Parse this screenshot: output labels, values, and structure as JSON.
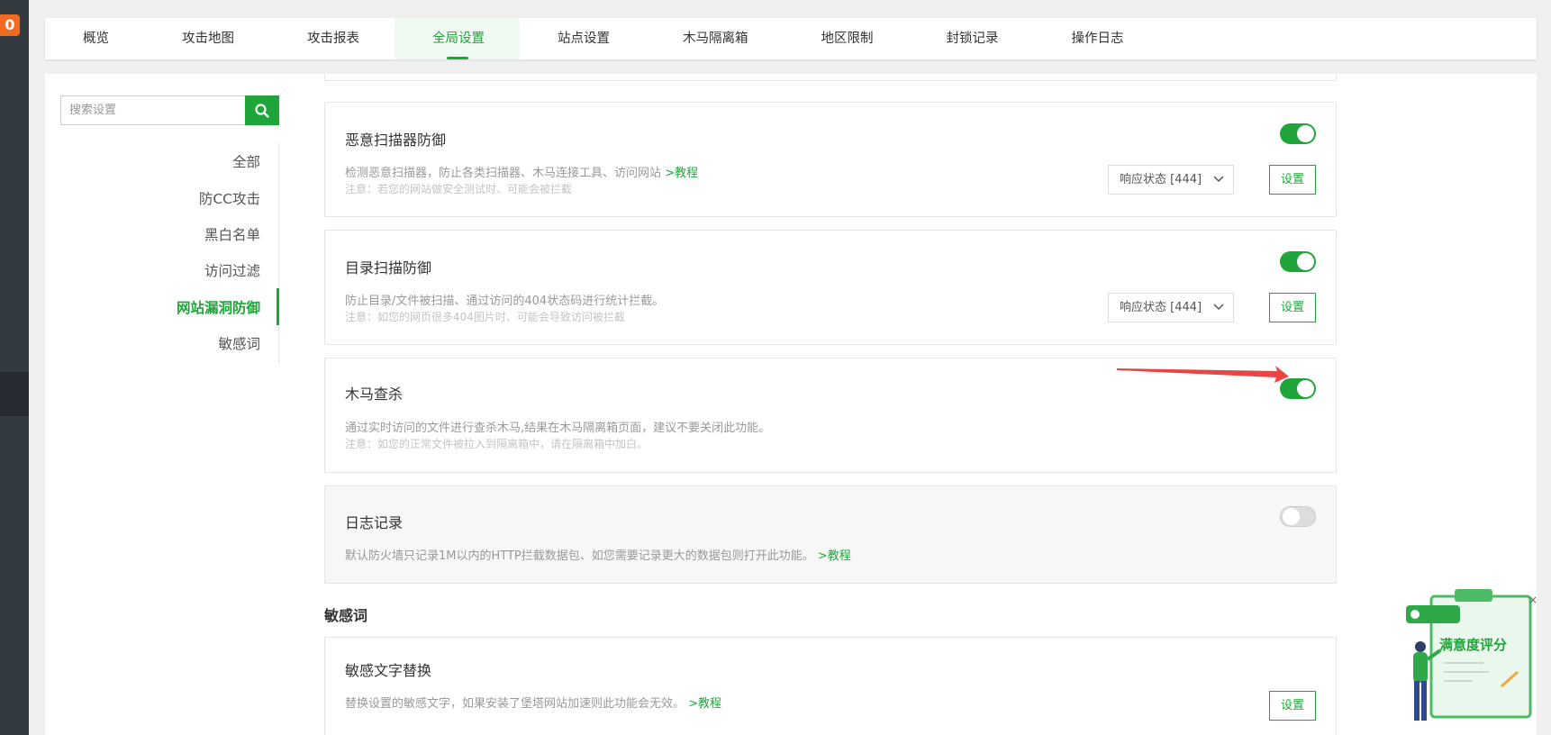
{
  "badge": "0",
  "tabs": [
    "概览",
    "攻击地图",
    "攻击报表",
    "全局设置",
    "站点设置",
    "木马隔离箱",
    "地区限制",
    "封锁记录",
    "操作日志"
  ],
  "active_tab": "全局设置",
  "search": {
    "placeholder": "搜索设置"
  },
  "side_nav": [
    "全部",
    "防CC攻击",
    "黑白名单",
    "访问过滤",
    "网站漏洞防御",
    "敏感词"
  ],
  "active_side": "网站漏洞防御",
  "cards": [
    {
      "title": "恶意扫描器防御",
      "desc": "检测恶意扫描器，防止各类扫描器、木马连接工具、访问网站 ",
      "link": ">教程",
      "note": "注意：若您的网站做安全测试时、可能会被拦截",
      "toggle": "on",
      "select": "响应状态 [444]",
      "button": "设置"
    },
    {
      "title": "目录扫描防御",
      "desc": "防止目录/文件被扫描、通过访问的404状态码进行统计拦截。",
      "note": "注意：如您的网页很多404图片时、可能会导致访问被拦截",
      "toggle": "on",
      "select": "响应状态 [444]",
      "button": "设置"
    },
    {
      "title": "木马查杀",
      "desc": "通过实时访问的文件进行查杀木马,结果在木马隔离箱页面，建议不要关闭此功能。",
      "note": "注意：如您的正常文件被拉入到隔离箱中，请在隔离箱中加白。",
      "toggle": "on"
    },
    {
      "title": "日志记录",
      "desc": "默认防火墙只记录1M以内的HTTP拦截数据包、如您需要记录更大的数据包则打开此功能。 ",
      "link": ">教程",
      "toggle": "off"
    }
  ],
  "section_title": "敏感词",
  "sensitive_card": {
    "title": "敏感文字替换",
    "desc": "替换设置的敏感文字，如果安装了堡塔网站加速则此功能会无效。 ",
    "link": ">教程",
    "button": "设置"
  },
  "widget": {
    "label": "满意度评分"
  },
  "colors": {
    "accent": "#20a53a",
    "badge": "#f06a22",
    "arrow": "#e84545"
  }
}
